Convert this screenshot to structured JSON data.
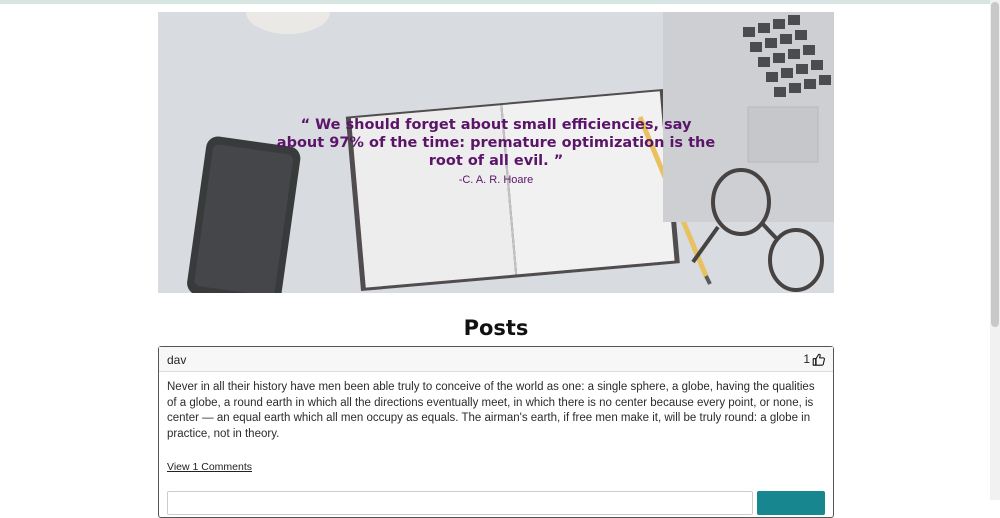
{
  "hero": {
    "quote": "“ We should forget about small efficiencies, say about 97% of the time: premature optimization is the root of all evil. ”",
    "author": "-C. A. R. Hoare"
  },
  "posts_title": "Posts",
  "posts": [
    {
      "author": "dav",
      "likes": "1",
      "body": "Never in all their history have men been able truly to conceive of the world as one: a single sphere, a globe, having the qualities of a globe, a round earth in which all the directions eventually meet, in which there is no center because every point, or none, is center — an equal earth which all men occupy as equals. The airman's earth, if free men make it, will be truly round: a globe in practice, not in theory.",
      "comments_link": "View 1 Comments"
    }
  ],
  "icons": {
    "like": "thumbs-up-icon"
  },
  "colors": {
    "quote": "#5a1568",
    "button": "#17868e"
  }
}
